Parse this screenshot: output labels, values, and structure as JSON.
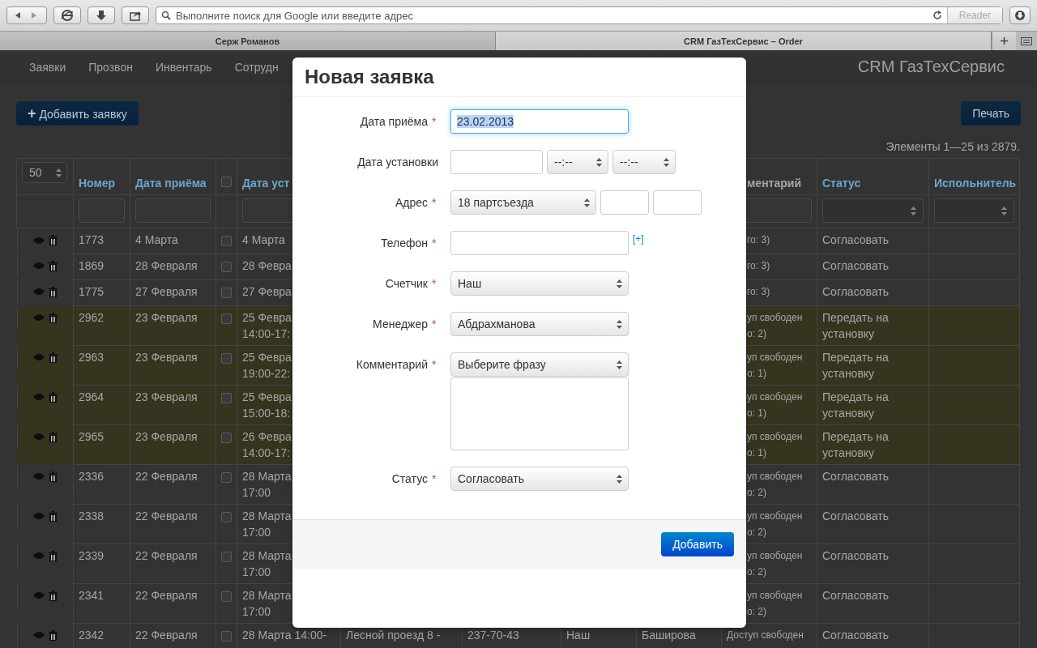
{
  "browser": {
    "address_placeholder": "Выполните поиск для Google или введите адрес",
    "reader": "Reader",
    "tabs": [
      {
        "label": "Серж Романов",
        "selected": false
      },
      {
        "label": "CRM ГазТехСервис – Order",
        "selected": true
      }
    ]
  },
  "navbar": {
    "items": [
      "Заявки",
      "Прозвон",
      "Инвентарь",
      "Сотрудн"
    ],
    "brand": "CRM ГазТехСервис"
  },
  "toolbar": {
    "add_icon": "+",
    "add_label": "Добавить заявку",
    "print": "Печать",
    "count": "Элементы 1—25 из 2879."
  },
  "table": {
    "page_size": "50",
    "columns": [
      {
        "label": "Номер",
        "kind": "link"
      },
      {
        "label": "Дата приёма",
        "kind": "link"
      },
      {
        "kind": "checkbox",
        "checked": false
      },
      {
        "label": "Дата уст",
        "kind": "link"
      },
      {
        "kind": "hidden"
      },
      {
        "kind": "hidden"
      },
      {
        "kind": "hidden"
      },
      {
        "kind": "hidden"
      },
      {
        "label": "ментарий",
        "kind": "plain"
      },
      {
        "label": "Статус",
        "kind": "link"
      },
      {
        "label": "Испольнитель",
        "kind": "link"
      }
    ],
    "rows": [
      {
        "number": "1773",
        "received": "4 Марта",
        "install": [
          "4 Марта"
        ],
        "comment": [
          "го: 3)"
        ],
        "status": "Согласовать",
        "highlighted": false,
        "covered": true,
        "checked": false
      },
      {
        "number": "1869",
        "received": "28 Февраля",
        "install": [
          "28 Февра"
        ],
        "comment": [
          "го: 3)"
        ],
        "status": "Согласовать",
        "highlighted": false,
        "covered": true,
        "checked": false
      },
      {
        "number": "1775",
        "received": "27 Февраля",
        "install": [
          "27 Февра"
        ],
        "comment": [
          "го: 3)"
        ],
        "status": "Согласовать",
        "highlighted": false,
        "covered": true,
        "checked": false
      },
      {
        "number": "2962",
        "received": "23 Февраля",
        "install": [
          "25 Февра",
          "14:00-17:"
        ],
        "comment": [
          "уп свободен",
          "о: 2)"
        ],
        "status": "Передать на установку",
        "highlighted": true,
        "covered": true,
        "checked": false
      },
      {
        "number": "2963",
        "received": "23 Февраля",
        "install": [
          "25 Февра",
          "19:00-22:"
        ],
        "comment": [
          "уп свободен",
          "о: 1)"
        ],
        "status": "Передать на установку",
        "highlighted": true,
        "covered": true,
        "checked": false
      },
      {
        "number": "2964",
        "received": "23 Февраля",
        "install": [
          "25 Февра",
          "15:00-18:"
        ],
        "comment": [
          "уп свободен",
          "о: 1)"
        ],
        "status": "Передать на установку",
        "highlighted": true,
        "covered": true,
        "checked": false
      },
      {
        "number": "2965",
        "received": "23 Февраля",
        "install": [
          "26 Февра",
          "14:00-17:"
        ],
        "comment": [
          "уп свободен",
          "о: 1)"
        ],
        "status": "Передать на установку",
        "highlighted": true,
        "covered": true,
        "checked": false
      },
      {
        "number": "2336",
        "received": "22 Февраля",
        "install": [
          "28 Марта",
          "17:00"
        ],
        "comment": [
          "уп свободен",
          "о: 2)"
        ],
        "status": "Согласовать",
        "highlighted": false,
        "covered": true,
        "checked": false
      },
      {
        "number": "2338",
        "received": "22 Февраля",
        "install": [
          "28 Марта",
          "17:00"
        ],
        "comment": [
          "уп свободен",
          "о: 2)"
        ],
        "status": "Согласовать",
        "highlighted": false,
        "covered": true,
        "checked": false
      },
      {
        "number": "2339",
        "received": "22 Февраля",
        "install": [
          "28 Марта",
          "17:00"
        ],
        "comment": [
          "уп свободен",
          "о: 2)"
        ],
        "status": "Согласовать",
        "highlighted": false,
        "covered": true,
        "checked": false
      },
      {
        "number": "2341",
        "received": "22 Февраля",
        "install": [
          "28 Марта",
          "17:00"
        ],
        "comment": [
          "уп свободен",
          "о: 2)"
        ],
        "status": "Согласовать",
        "highlighted": false,
        "covered": true,
        "checked": false
      },
      {
        "number": "2342",
        "received": "22 Февраля",
        "install": [
          "28 Марта 14:00-"
        ],
        "address": "Лесной проезд 8 -",
        "phone": "237-70-43",
        "meter": "Наш",
        "manager": "Баширова",
        "comment": [
          "Доступ свободен"
        ],
        "status": "Согласовать",
        "highlighted": false,
        "covered": false,
        "checked": false
      }
    ]
  },
  "modal": {
    "title": "Новая заявка",
    "fields": [
      {
        "label": "Дата приёма",
        "mark": "*",
        "kind": "input",
        "value": "23.02.2013",
        "focused": true
      },
      {
        "label": "Дата установки",
        "kind": "datetime",
        "time_from": "--:--",
        "time_to": "--:--"
      },
      {
        "label": "Адрес",
        "mark": "*",
        "kind": "address",
        "value": "18 партсъезда"
      },
      {
        "label": "Телефон",
        "mark": "*",
        "kind": "phone",
        "add_link": "[+]"
      },
      {
        "label": "Счетчик",
        "mark": "*",
        "kind": "select",
        "value": "Наш"
      },
      {
        "label": "Менеджер",
        "mark": "*",
        "kind": "select",
        "value": "Абдрахманова"
      },
      {
        "label": "Комментарий",
        "mark": "*",
        "kind": "comment",
        "value": "Выберите фразу"
      },
      {
        "label": "Статус",
        "mark": "*",
        "kind": "select",
        "value": "Согласовать"
      }
    ],
    "submit": "Добавить"
  }
}
